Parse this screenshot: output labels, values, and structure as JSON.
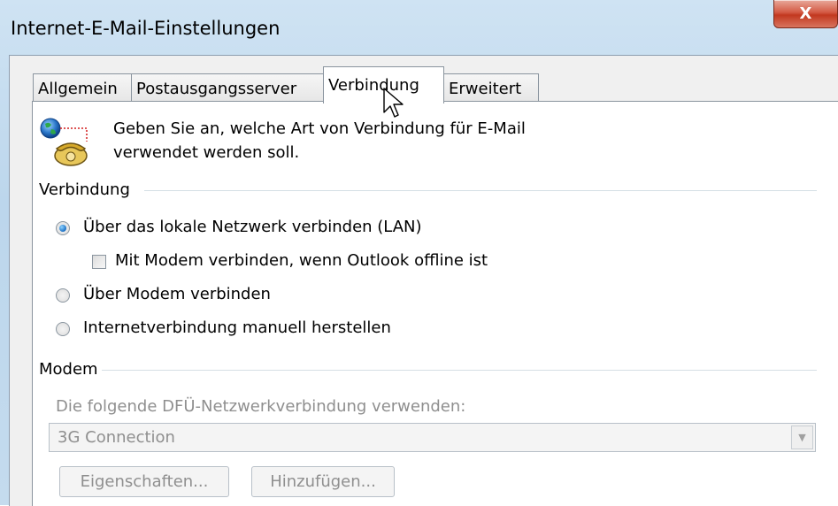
{
  "window": {
    "title": "Internet-E-Mail-Einstellungen",
    "close_label": "X"
  },
  "tabs": [
    {
      "label": "Allgemein",
      "active": false
    },
    {
      "label": "Postausgangsserver",
      "active": false
    },
    {
      "label": "Verbindung",
      "active": true
    },
    {
      "label": "Erweitert",
      "active": false
    }
  ],
  "header": {
    "line1": "Geben Sie an, welche Art von Verbindung für E-Mail",
    "line2": "verwendet werden soll.",
    "icon": "globe-phone-icon"
  },
  "connection_group": {
    "label": "Verbindung",
    "options": [
      {
        "label": "Über das lokale Netzwerk verbinden (LAN)",
        "checked": true
      },
      {
        "label": "Über Modem verbinden",
        "checked": false
      },
      {
        "label": "Internetverbindung manuell herstellen",
        "checked": false
      }
    ],
    "offline_checkbox": {
      "label": "Mit Modem verbinden, wenn Outlook offline ist",
      "checked": false
    }
  },
  "modem_group": {
    "label": "Modem",
    "dialup_label": "Die folgende DFÜ-Netzwerkverbindung verwenden:",
    "dialup_value": "3G Connection",
    "properties_button": "Eigenschaften...",
    "add_button": "Hinzufügen..."
  },
  "colors": {
    "title_bar": "#c4dbee",
    "close_button": "#c2381f",
    "panel": "#ffffff",
    "disabled_text": "#8f8f8f"
  }
}
